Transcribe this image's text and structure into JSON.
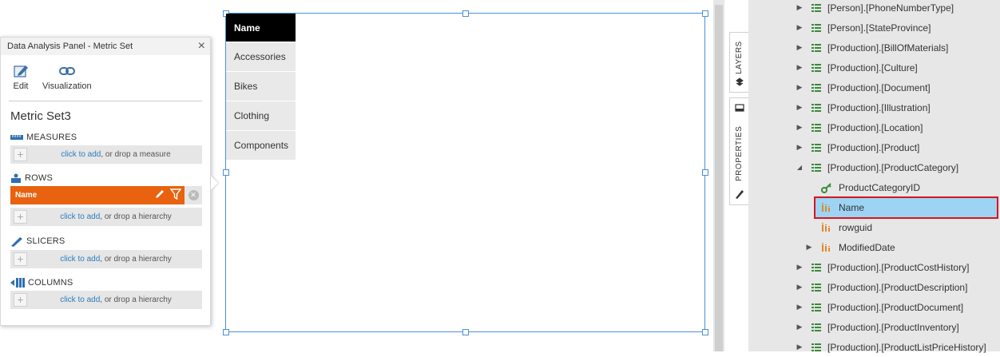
{
  "panel": {
    "title": "Data Analysis Panel - Metric Set",
    "close": "×",
    "toolbar": {
      "edit": "Edit",
      "visualization": "Visualization"
    },
    "metric_set_name": "Metric Set3",
    "measures_label": "MEASURES",
    "rows_label": "ROWS",
    "slicers_label": "SLICERS",
    "columns_label": "COLUMNS",
    "click_to_add": "click to add",
    "drop_measure": ", or drop a measure",
    "drop_hierarchy": ", or drop a hierarchy",
    "row_item": "Name",
    "accent": "#e8620f"
  },
  "widget": {
    "header": "Name",
    "items": [
      "Accessories",
      "Bikes",
      "Clothing",
      "Components"
    ]
  },
  "side_tabs": {
    "layers": "LAYERS",
    "properties": "PROPERTIES"
  },
  "tree": {
    "nodes": [
      {
        "label": "[Person].[PhoneNumberType]",
        "type": "table",
        "expanded": false
      },
      {
        "label": "[Person].[StateProvince]",
        "type": "table",
        "expanded": false
      },
      {
        "label": "[Production].[BillOfMaterials]",
        "type": "table",
        "expanded": false
      },
      {
        "label": "[Production].[Culture]",
        "type": "table",
        "expanded": false
      },
      {
        "label": "[Production].[Document]",
        "type": "table",
        "expanded": false
      },
      {
        "label": "[Production].[Illustration]",
        "type": "table",
        "expanded": false
      },
      {
        "label": "[Production].[Location]",
        "type": "table",
        "expanded": false
      },
      {
        "label": "[Production].[Product]",
        "type": "table",
        "expanded": false
      },
      {
        "label": "[Production].[ProductCategory]",
        "type": "table",
        "expanded": true
      },
      {
        "label": "ProductCategoryID",
        "type": "key",
        "child": true
      },
      {
        "label": "Name",
        "type": "hierarchy",
        "child": true,
        "selected": true
      },
      {
        "label": "rowguid",
        "type": "hierarchy",
        "child": true
      },
      {
        "label": "ModifiedDate",
        "type": "hierarchy",
        "child": true,
        "expandable": true
      },
      {
        "label": "[Production].[ProductCostHistory]",
        "type": "table",
        "expanded": false
      },
      {
        "label": "[Production].[ProductDescription]",
        "type": "table",
        "expanded": false
      },
      {
        "label": "[Production].[ProductDocument]",
        "type": "table",
        "expanded": false
      },
      {
        "label": "[Production].[ProductInventory]",
        "type": "table",
        "expanded": false
      },
      {
        "label": "[Production].[ProductListPriceHistory]",
        "type": "table",
        "expanded": false
      }
    ]
  }
}
